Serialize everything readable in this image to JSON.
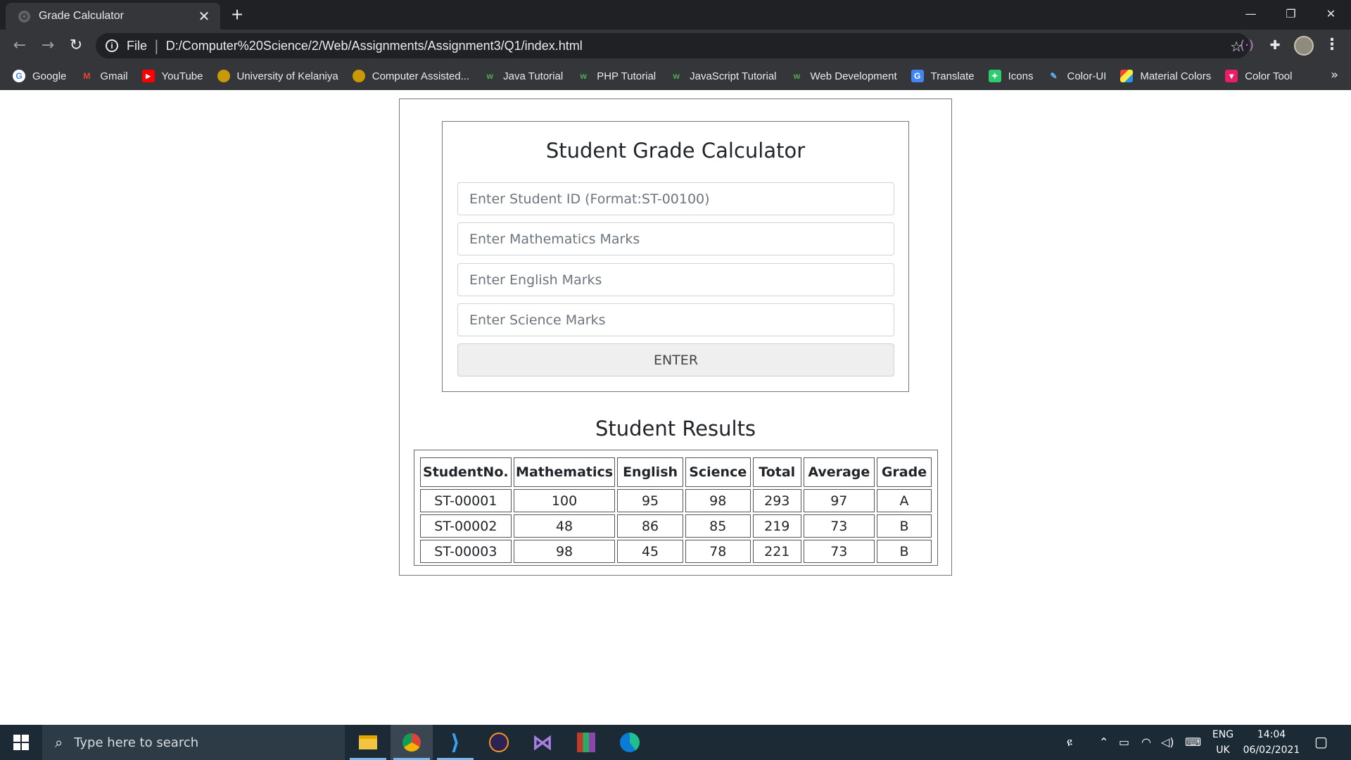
{
  "browser": {
    "tab_title": "Grade Calculator",
    "url_scheme": "File",
    "url": "D:/Computer%20Science/2/Web/Assignments/Assignment3/Q1/index.html",
    "bookmarks": [
      {
        "label": "Google",
        "icon": "google-icon"
      },
      {
        "label": "Gmail",
        "icon": "gmail-icon"
      },
      {
        "label": "YouTube",
        "icon": "youtube-icon"
      },
      {
        "label": "University of Kelaniya",
        "icon": "university-icon"
      },
      {
        "label": "Computer Assisted...",
        "icon": "university-icon"
      },
      {
        "label": "Java Tutorial",
        "icon": "w3schools-icon"
      },
      {
        "label": "PHP Tutorial",
        "icon": "w3schools-icon"
      },
      {
        "label": "JavaScript Tutorial",
        "icon": "w3schools-icon"
      },
      {
        "label": "Web Development",
        "icon": "w3schools-icon"
      },
      {
        "label": "Translate",
        "icon": "translate-icon"
      },
      {
        "label": "Icons",
        "icon": "icons-icon"
      },
      {
        "label": "Color-UI",
        "icon": "color-ui-icon"
      },
      {
        "label": "Material Colors",
        "icon": "material-colors-icon"
      },
      {
        "label": "Color Tool",
        "icon": "color-tool-icon"
      }
    ],
    "more": "»"
  },
  "form": {
    "title": "Student Grade Calculator",
    "student_id_placeholder": "Enter Student ID (Format:ST-00100)",
    "math_placeholder": "Enter Mathematics Marks",
    "english_placeholder": "Enter English Marks",
    "science_placeholder": "Enter Science Marks",
    "enter_label": "ENTER"
  },
  "results": {
    "title": "Student Results",
    "headers": [
      "StudentNo.",
      "Mathematics",
      "English",
      "Science",
      "Total",
      "Average",
      "Grade"
    ],
    "rows": [
      [
        "ST-00001",
        "100",
        "95",
        "98",
        "293",
        "97",
        "A"
      ],
      [
        "ST-00002",
        "48",
        "86",
        "85",
        "219",
        "73",
        "B"
      ],
      [
        "ST-00003",
        "98",
        "45",
        "78",
        "221",
        "73",
        "B"
      ]
    ]
  },
  "taskbar": {
    "search_placeholder": "Type here to search",
    "lang_top": "ENG",
    "lang_bottom": "UK",
    "time": "14:04",
    "date": "06/02/2021"
  },
  "colors": {
    "chrome_dark": "#202124",
    "chrome_toolbar": "#35363a",
    "taskbar": "#1c2a36"
  }
}
